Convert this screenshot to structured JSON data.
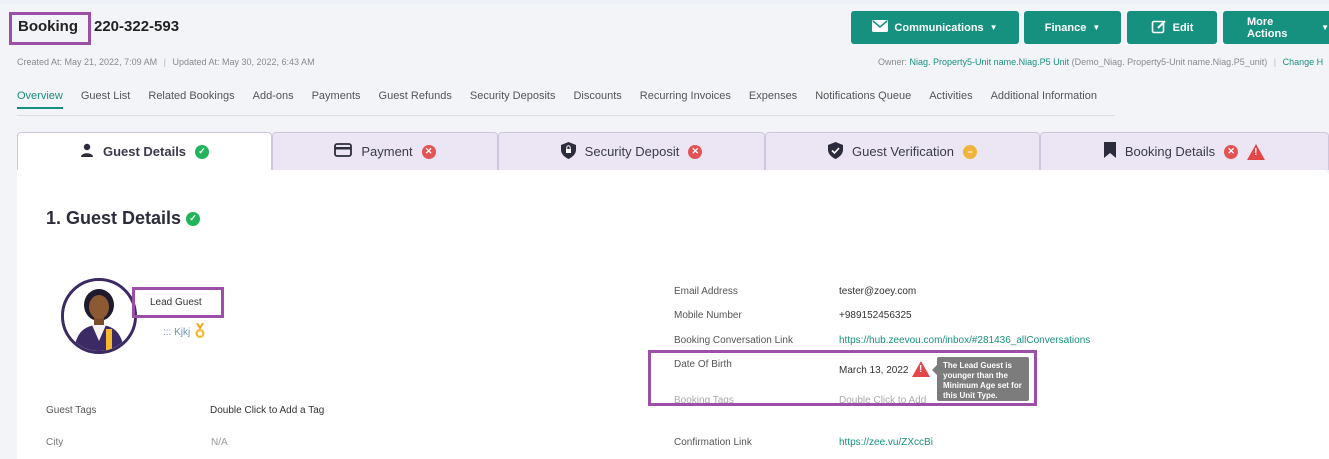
{
  "header": {
    "booking_label": "Booking",
    "booking_number": "220-322-593",
    "created": "Created At: May 21, 2022, 7:09 AM",
    "updated": "Updated At: May 30, 2022, 6:43 AM",
    "owner_prefix": "Owner:",
    "owner_link": "Niag. Property5-Unit name.Niag.P5 Unit",
    "owner_paren": "(Demo_Niag. Property5-Unit name.Niag.P5_unit)",
    "change_link": "Change H"
  },
  "actions": {
    "communications": "Communications",
    "finance": "Finance",
    "edit": "Edit",
    "more": "More Actions"
  },
  "subnav": [
    "Overview",
    "Guest List",
    "Related Bookings",
    "Add-ons",
    "Payments",
    "Guest Refunds",
    "Security Deposits",
    "Discounts",
    "Recurring Invoices",
    "Expenses",
    "Notifications Queue",
    "Activities",
    "Additional Information"
  ],
  "steps": {
    "guest_details": "Guest Details",
    "payment": "Payment",
    "security_deposit": "Security Deposit",
    "guest_verification": "Guest Verification",
    "booking_details": "Booking Details"
  },
  "section": {
    "title": "1. Guest Details",
    "lead_guest": "Lead Guest",
    "guest_name": "::: Kjkj",
    "guest_tags_label": "Guest Tags",
    "guest_tags_value": "Double Click to Add a Tag",
    "city_label": "City",
    "city_value": "N/A"
  },
  "details": {
    "email_label": "Email Address",
    "email_value": "tester@zoey.com",
    "mobile_label": "Mobile Number",
    "mobile_value": "+989152456325",
    "conv_label": "Booking Conversation Link",
    "conv_value": "https://hub.zeevou.com/inbox/#281436_allConversations",
    "dob_label": "Date Of Birth",
    "dob_value": "March 13, 2022",
    "tags_label": "Booking Tags",
    "tags_value": "Double Click to Add",
    "confirm_label": "Confirmation Link",
    "confirm_value": "https://zee.vu/ZXccBi"
  },
  "tooltip": "The Lead Guest is younger than the Minimum Age set for this Unit Type.",
  "colors": {
    "accent": "#17917f",
    "highlight": "#9b4fa6",
    "ok": "#22b45a",
    "error": "#e35353",
    "warning": "#f0b43a"
  }
}
